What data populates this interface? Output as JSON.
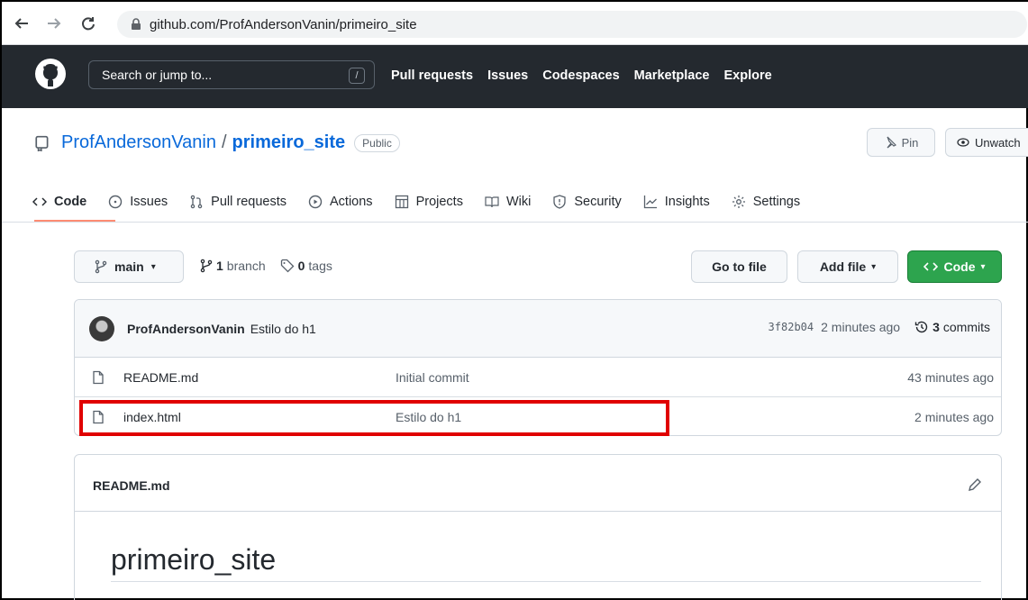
{
  "browser": {
    "url": "github.com/ProfAndersonVanin/primeiro_site"
  },
  "header": {
    "search_placeholder": "Search or jump to...",
    "search_shortcut": "/",
    "nav": [
      "Pull requests",
      "Issues",
      "Codespaces",
      "Marketplace",
      "Explore"
    ]
  },
  "repo": {
    "owner": "ProfAndersonVanin",
    "separator": "/",
    "name": "primeiro_site",
    "visibility": "Public",
    "pin_label": "Pin",
    "unwatch_label": "Unwatch"
  },
  "tabs": [
    {
      "label": "Code",
      "icon": "code-icon"
    },
    {
      "label": "Issues",
      "icon": "issue-icon"
    },
    {
      "label": "Pull requests",
      "icon": "pull-request-icon"
    },
    {
      "label": "Actions",
      "icon": "play-icon"
    },
    {
      "label": "Projects",
      "icon": "table-icon"
    },
    {
      "label": "Wiki",
      "icon": "book-icon"
    },
    {
      "label": "Security",
      "icon": "shield-icon"
    },
    {
      "label": "Insights",
      "icon": "graph-icon"
    },
    {
      "label": "Settings",
      "icon": "gear-icon"
    }
  ],
  "toolbar": {
    "branch": "main",
    "branch_count": "1",
    "branch_word": "branch",
    "tag_count": "0",
    "tag_word": "tags",
    "goto_file": "Go to file",
    "add_file": "Add file",
    "code": "Code"
  },
  "latest_commit": {
    "author": "ProfAndersonVanin",
    "message": "Estilo do h1",
    "sha": "3f82b04",
    "age": "2 minutes ago",
    "commit_count": "3",
    "commit_word": "commits"
  },
  "files": [
    {
      "name": "README.md",
      "commit": "Initial commit",
      "age": "43 minutes ago"
    },
    {
      "name": "index.html",
      "commit": "Estilo do h1",
      "age": "2 minutes ago"
    }
  ],
  "readme": {
    "file_label": "README.md",
    "heading": "primeiro_site"
  },
  "colors": {
    "header_bg": "#24292f",
    "link": "#0969da",
    "primary_button": "#2da44e",
    "highlight": "#e00000",
    "active_tab_underline": "#fd8c73"
  }
}
